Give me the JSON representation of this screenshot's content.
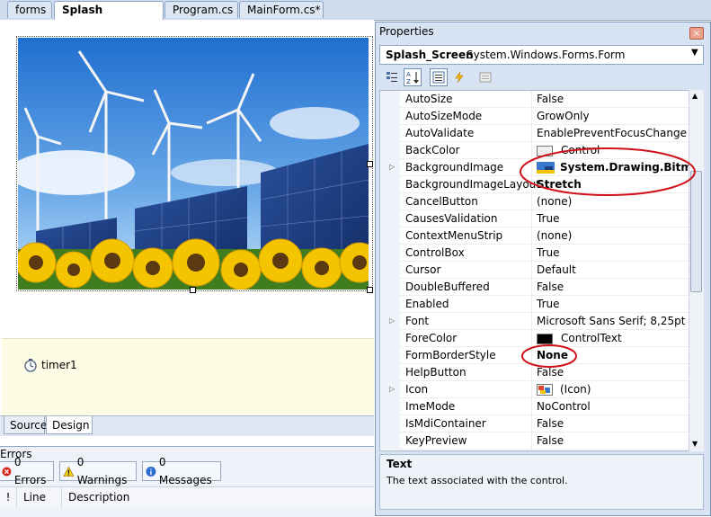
{
  "tabs": [
    {
      "label": "forms",
      "active": false
    },
    {
      "label": "Splash Screen.cs*",
      "active": true
    },
    {
      "label": "Program.cs",
      "active": false
    },
    {
      "label": "MainForm.cs*",
      "active": false
    }
  ],
  "designer": {
    "component": {
      "icon": "timer-icon",
      "label": "timer1"
    },
    "view_tabs": {
      "source": "Source",
      "design": "Design"
    }
  },
  "error_list": {
    "title": "Errors",
    "errors": "0 Errors",
    "warnings": "0 Warnings",
    "messages": "0 Messages",
    "columns": {
      "bang": "!",
      "line": "Line",
      "description": "Description"
    }
  },
  "properties": {
    "title": "Properties",
    "close_glyph": "×",
    "object_name": "Splash_Screen",
    "object_type": "System.Windows.Forms.Form",
    "rows": [
      {
        "name": "AutoSize",
        "value": "False"
      },
      {
        "name": "AutoSizeMode",
        "value": "GrowOnly"
      },
      {
        "name": "AutoValidate",
        "value": "EnablePreventFocusChange"
      },
      {
        "name": "BackColor",
        "value": "Control",
        "swatch": "#f0f0f0"
      },
      {
        "name": "BackgroundImage",
        "value": "System.Drawing.Bitmap",
        "bold": true,
        "expandable": true,
        "thumbnail": true
      },
      {
        "name": "BackgroundImageLayout",
        "value": "Stretch",
        "bold": true
      },
      {
        "name": "CancelButton",
        "value": "(none)"
      },
      {
        "name": "CausesValidation",
        "value": "True"
      },
      {
        "name": "ContextMenuStrip",
        "value": "(none)"
      },
      {
        "name": "ControlBox",
        "value": "True"
      },
      {
        "name": "Cursor",
        "value": "Default"
      },
      {
        "name": "DoubleBuffered",
        "value": "False"
      },
      {
        "name": "Enabled",
        "value": "True"
      },
      {
        "name": "Font",
        "value": "Microsoft Sans Serif; 8,25pt",
        "expandable": true
      },
      {
        "name": "ForeColor",
        "value": "ControlText",
        "swatch": "#000000"
      },
      {
        "name": "FormBorderStyle",
        "value": "None",
        "bold": true
      },
      {
        "name": "HelpButton",
        "value": "False"
      },
      {
        "name": "Icon",
        "value": "(Icon)",
        "expandable": true,
        "icon": true
      },
      {
        "name": "ImeMode",
        "value": "NoControl"
      },
      {
        "name": "IsMdiContainer",
        "value": "False"
      },
      {
        "name": "KeyPreview",
        "value": "False"
      }
    ],
    "description": {
      "title": "Text",
      "text": "The text associated with the control."
    }
  },
  "colors": {
    "annotation_red": "#d0101a",
    "selection_dot": "#000000"
  }
}
